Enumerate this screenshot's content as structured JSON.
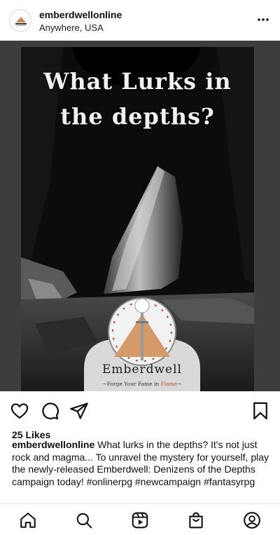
{
  "header": {
    "username": "emberdwellonline",
    "location": "Anywhere, USA",
    "avatar_icon": "emberdwell-logo-icon",
    "more_icon": "more-horizontal-icon"
  },
  "post": {
    "headline_line1": "What Lurks in",
    "headline_line2": "the depths?",
    "brand_name": "Emberdwell",
    "tagline_prefix": "~Forge Your Fame in ",
    "tagline_flame": "Flame",
    "tagline_suffix": "~"
  },
  "actions": {
    "like_icon": "heart-icon",
    "comment_icon": "comment-icon",
    "share_icon": "send-icon",
    "save_icon": "bookmark-icon"
  },
  "likes": "25 Likes",
  "caption": {
    "username": "emberdwellonline",
    "text": "What lurks in the depths? It's not just rock and magma... To unravel the mystery for yourself, play the newly-released Emberdwell: Denizens of the Depths campaign today! #onlinerpg #newcampaign #fantasyrpg"
  },
  "nav": [
    "home-icon",
    "search-icon",
    "reels-icon",
    "shop-icon",
    "profile-icon"
  ],
  "colors": {
    "accent_flame": "#b84a37",
    "mountain": "#d49a6a",
    "background": "#ffffff"
  }
}
